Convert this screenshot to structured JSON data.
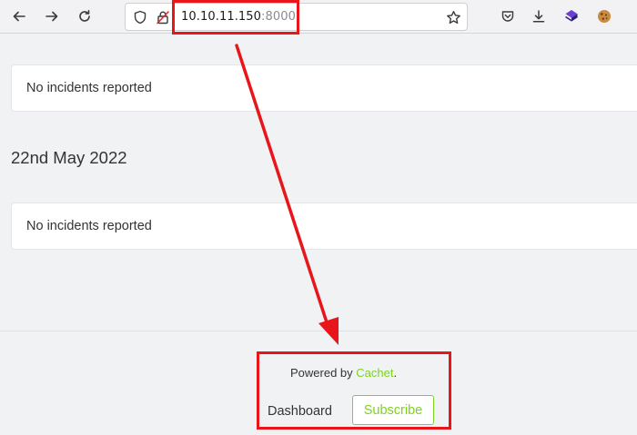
{
  "browser": {
    "url_host": "10.10.11.150",
    "url_port": ":8000",
    "icons": {
      "back": "arrow-left-icon",
      "forward": "arrow-right-icon",
      "reload": "reload-icon",
      "tracking": "shield-icon",
      "insecure": "insecure-lock-icon",
      "bookmark": "star-icon",
      "pocket": "pocket-icon",
      "download": "download-icon",
      "extension_1": "purple-stack-icon",
      "extension_2": "cookie-icon"
    }
  },
  "incidents": {
    "first_card": "No incidents reported",
    "date": "22nd May 2022",
    "second_card": "No incidents reported"
  },
  "footer": {
    "powered_prefix": "Powered by ",
    "powered_link": "Cachet",
    "powered_suffix": ".",
    "dashboard": "Dashboard",
    "subscribe": "Subscribe"
  },
  "colors": {
    "accent": "#7ed321",
    "annotation": "#e8161b"
  }
}
